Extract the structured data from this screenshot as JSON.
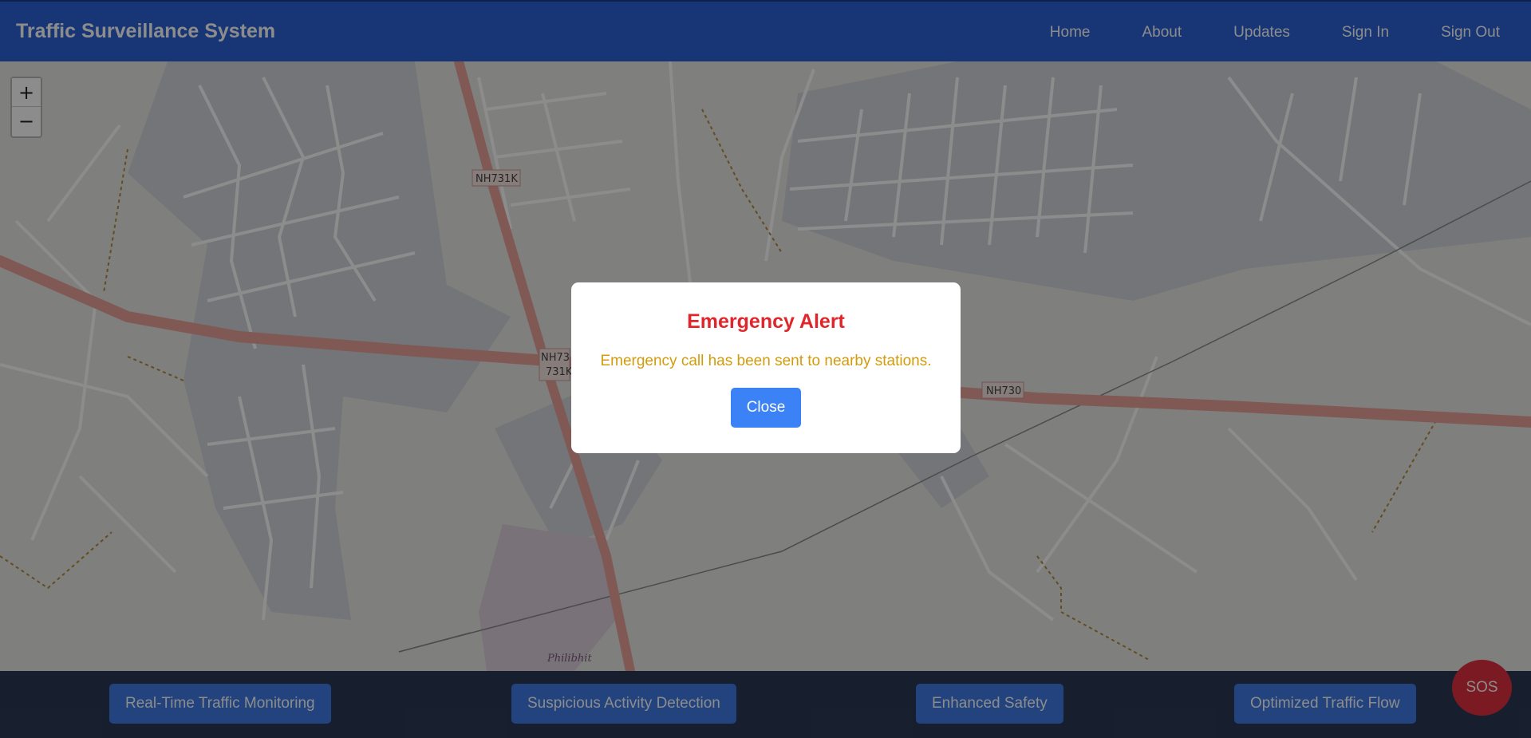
{
  "header": {
    "brand": "Traffic Surveillance System",
    "nav": [
      "Home",
      "About",
      "Updates",
      "Sign In",
      "Sign Out"
    ]
  },
  "map": {
    "zoom_in": "+",
    "zoom_out": "−",
    "road_labels": [
      "NH731K",
      "NH73",
      "731K",
      "NH730"
    ],
    "place_label": "Philibhit"
  },
  "features": [
    "Real-Time Traffic Monitoring",
    "Suspicious Activity Detection",
    "Enhanced Safety",
    "Optimized Traffic Flow"
  ],
  "sos_label": "SOS",
  "modal": {
    "title": "Emergency Alert",
    "message": "Emergency call has been sent to nearby stations.",
    "close_label": "Close"
  },
  "colors": {
    "header": "#2d63d8",
    "footer": "#2b3a55",
    "alert_title": "#e0262b",
    "alert_message": "#d39b0c",
    "button": "#3b82f6",
    "sos": "#e0303f"
  }
}
